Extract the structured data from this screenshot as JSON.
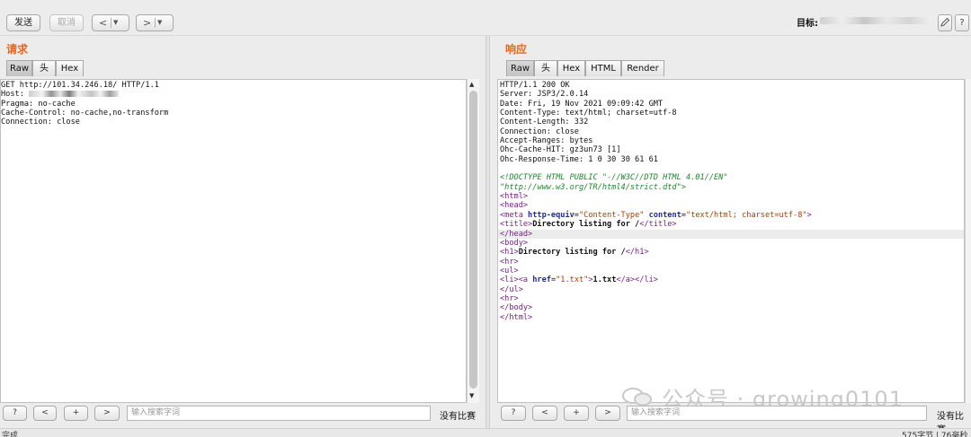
{
  "toolbar": {
    "send_label": "发送",
    "cancel_label": "取消",
    "back_arrow": "<",
    "forward_arrow": ">",
    "dropdown_caret": "▼",
    "target_label": "目标:",
    "edit_icon": "pencil-icon",
    "help_label": "?"
  },
  "request": {
    "title": "请求",
    "tabs": [
      "Raw",
      "头",
      "Hex"
    ],
    "active_tab": "Raw",
    "line_1": "GET http://101.34.246.18/ HTTP/1.1",
    "line_2_prefix": "Host: ",
    "line_3": "Pragma: no-cache",
    "line_4": "Cache-Control: no-cache,no-transform",
    "line_5": "Connection: close"
  },
  "response": {
    "title": "响应",
    "tabs": [
      "Raw",
      "头",
      "Hex",
      "HTML",
      "Render"
    ],
    "active_tab": "Raw",
    "headers": [
      "HTTP/1.1 200 OK",
      "Server: JSP3/2.0.14",
      "Date: Fri, 19 Nov 2021 09:09:42 GMT",
      "Content-Type: text/html; charset=utf-8",
      "Content-Length: 332",
      "Connection: close",
      "Accept-Ranges: bytes",
      "Ohc-Cache-HIT: gz3un73 [1]",
      "Ohc-Response-Time: 1 0 30 30 61 61"
    ],
    "body": {
      "doctype_1": "<!DOCTYPE HTML PUBLIC \"-//W3C//DTD HTML 4.01//EN\"",
      "doctype_2": "\"http://www.w3.org/TR/html4/strict.dtd\">",
      "html_open": "<html>",
      "head_open": "<head>",
      "meta_open": "<meta ",
      "meta_attr_1": "http-equiv",
      "meta_val_1": "\"Content-Type\"",
      "meta_attr_2": "content",
      "meta_val_2": "\"text/html; charset=utf-8\"",
      "meta_close": ">",
      "title_open": "<title>",
      "title_text": "Directory listing for /",
      "title_close": "</title>",
      "head_close": "</head>",
      "body_open": "<body>",
      "h1_open": "<h1>",
      "h1_text": "Directory listing for /",
      "h1_close": "</h1>",
      "hr_1": "<hr>",
      "ul_open": "<ul>",
      "li_open": "<li>",
      "a_open": "<a ",
      "a_attr": "href",
      "a_val": "\"1.txt\"",
      "a_gt": ">",
      "a_text": "1.txt",
      "a_close": "</a>",
      "li_close": "</li>",
      "ul_close": "</ul>",
      "hr_2": "<hr>",
      "body_close": "</body>",
      "html_close": "</html>"
    }
  },
  "search_bar": {
    "help": "?",
    "prev": "<",
    "add": "+",
    "next": ">",
    "placeholder": "输入搜索字词",
    "no_match": "没有比赛"
  },
  "status": {
    "left": "完成",
    "right": "575字节 | 76毫秒"
  },
  "watermark": {
    "text": "公众号 · growing0101"
  },
  "colors": {
    "pane_title": "#e8651d",
    "tag": "#7a1f8b",
    "attr": "#2424b8",
    "value": "#b33a00",
    "doctype": "#1b8a2a"
  }
}
